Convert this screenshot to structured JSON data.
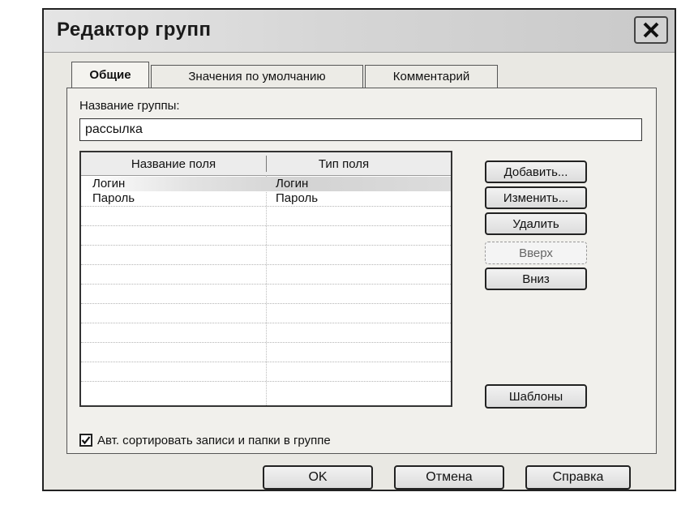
{
  "window": {
    "title": "Редактор групп"
  },
  "tabs": [
    {
      "label": "Общие",
      "active": true
    },
    {
      "label": "Значения по умолчанию",
      "active": false
    },
    {
      "label": "Комментарий",
      "active": false
    }
  ],
  "general": {
    "group_name_label": "Название группы:",
    "group_name_value": "рассылка"
  },
  "fields_table": {
    "columns": [
      "Название поля",
      "Тип поля"
    ],
    "rows": [
      {
        "name": "Логин",
        "type": "Логин",
        "selected": true
      },
      {
        "name": "Пароль",
        "type": "Пароль",
        "selected": false
      }
    ]
  },
  "side_buttons": {
    "add": "Добавить...",
    "edit": "Изменить...",
    "delete": "Удалить",
    "up": "Вверх",
    "down": "Вниз",
    "templates": "Шаблоны"
  },
  "auto_sort": {
    "label": "Авт. сортировать записи и папки в группе",
    "checked": true
  },
  "footer": {
    "ok": "OK",
    "cancel": "Отмена",
    "help": "Справка"
  },
  "colors": {
    "dialog_bg": "#e9e8e3",
    "panel_bg": "#f1f0ec",
    "border": "#222222"
  },
  "icons": {
    "close": "close-icon",
    "check": "checkmark-icon"
  }
}
